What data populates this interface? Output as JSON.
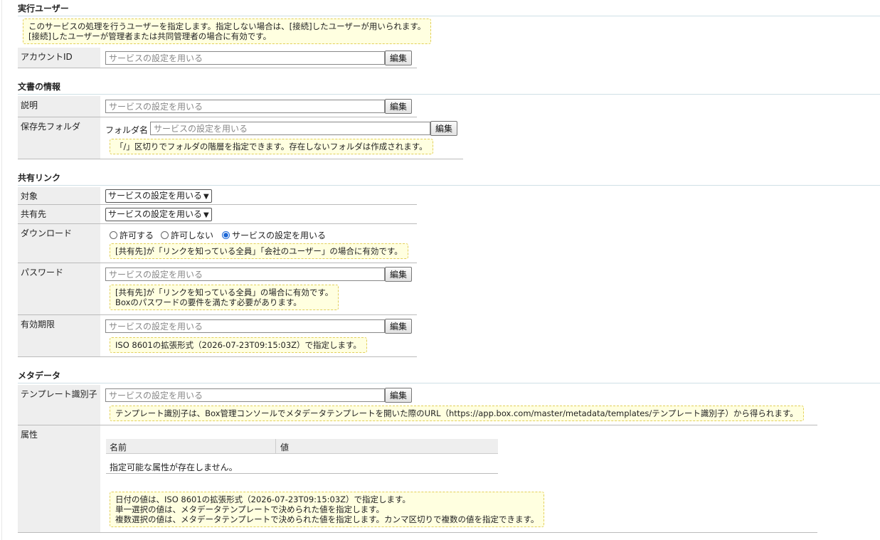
{
  "sections": {
    "executor": {
      "title": "実行ユーザー"
    },
    "document": {
      "title": "文書の情報"
    },
    "shared_link": {
      "title": "共有リンク"
    },
    "metadata": {
      "title": "メタデータ"
    }
  },
  "executor": {
    "note_line1": "このサービスの処理を行うユーザーを指定します。指定しない場合は、[接続]したユーザーが用いられます。",
    "note_line2": "[接続]したユーザーが管理者または共同管理者の場合に有効です。",
    "account_label": "アカウントID",
    "account_placeholder": "サービスの設定を用いる",
    "edit": "編集"
  },
  "document": {
    "desc_label": "説明",
    "desc_placeholder": "サービスの設定を用いる",
    "folder_label": "保存先フォルダ",
    "folder_name_label": "フォルダ名",
    "folder_placeholder": "サービスの設定を用いる",
    "folder_note": "「/」区切りでフォルダの階層を指定できます。存在しないフォルダは作成されます。",
    "edit": "編集"
  },
  "shared_link": {
    "target_label": "対象",
    "target_value": "サービスの設定を用いる",
    "share_label": "共有先",
    "share_value": "サービスの設定を用いる",
    "download_label": "ダウンロード",
    "download_options": [
      "許可する",
      "許可しない",
      "サービスの設定を用いる"
    ],
    "download_selected": 2,
    "download_note": "[共有先]が「リンクを知っている全員」「会社のユーザー」の場合に有効です。",
    "password_label": "パスワード",
    "password_placeholder": "サービスの設定を用いる",
    "password_note_line1": "[共有先]が「リンクを知っている全員」の場合に有効です。",
    "password_note_line2": "Boxのパスワードの要件を満たす必要があります。",
    "expiry_label": "有効期限",
    "expiry_placeholder": "サービスの設定を用いる",
    "expiry_note": "ISO 8601の拡張形式（2026-07-23T09:15:03Z）で指定します。",
    "edit": "編集"
  },
  "metadata": {
    "template_label": "テンプレート識別子",
    "template_placeholder": "サービスの設定を用いる",
    "template_note": "テンプレート識別子は、Box管理コンソールでメタデータテンプレートを開いた際のURL（https://app.box.com/master/metadata/templates/テンプレート識別子）から得られます。",
    "attr_label": "属性",
    "col_name": "名前",
    "col_value": "値",
    "empty_text": "指定可能な属性が存在しません。",
    "attr_note_line1": "日付の値は、ISO 8601の拡張形式（2026-07-23T09:15:03Z）で指定します。",
    "attr_note_line2": "単一選択の値は、メタデータテンプレートで決められた値を指定します。",
    "attr_note_line3": "複数選択の値は、メタデータテンプレートで決められた値を指定します。カンマ区切りで複数の値を指定できます。",
    "edit": "編集"
  }
}
